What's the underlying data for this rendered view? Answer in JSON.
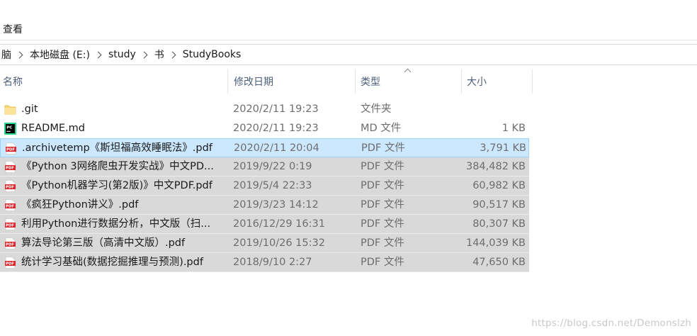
{
  "ribbon": {
    "view_tab": "查看"
  },
  "breadcrumb": [
    "脑",
    "本地磁盘 (E:)",
    "study",
    "书",
    "StudyBooks"
  ],
  "columns": {
    "name": "名称",
    "date": "修改日期",
    "type": "类型",
    "size": "大小"
  },
  "files": [
    {
      "name": ".git",
      "date": "2020/2/11 19:23",
      "type": "文件夹",
      "size": "",
      "icon": "folder-icon",
      "state": "normal"
    },
    {
      "name": "README.md",
      "date": "2020/2/11 19:23",
      "type": "MD 文件",
      "size": "1 KB",
      "icon": "pycharm-file-icon",
      "state": "normal"
    },
    {
      "name": ".archivetemp《斯坦福高效睡眠法》.pdf",
      "date": "2020/2/11 20:04",
      "type": "PDF 文件",
      "size": "3,791 KB",
      "icon": "pdf-icon",
      "state": "selected"
    },
    {
      "name": "《Python 3网络爬虫开发实战》中文PD...",
      "date": "2019/9/22 0:19",
      "type": "PDF 文件",
      "size": "384,482 KB",
      "icon": "pdf-icon",
      "state": "gray"
    },
    {
      "name": "《Python机器学习(第2版)》中文PDF.pdf",
      "date": "2019/5/4 22:33",
      "type": "PDF 文件",
      "size": "60,982 KB",
      "icon": "pdf-icon",
      "state": "gray"
    },
    {
      "name": "《疯狂Python讲义》.pdf",
      "date": "2019/3/23 14:12",
      "type": "PDF 文件",
      "size": "90,517 KB",
      "icon": "pdf-icon",
      "state": "gray"
    },
    {
      "name": "利用Python进行数据分析，中文版（扫...",
      "date": "2016/12/29 16:31",
      "type": "PDF 文件",
      "size": "80,307 KB",
      "icon": "pdf-icon",
      "state": "gray"
    },
    {
      "name": "算法导论第三版（高清中文版）.pdf",
      "date": "2019/10/26 15:32",
      "type": "PDF 文件",
      "size": "144,039 KB",
      "icon": "pdf-icon",
      "state": "gray"
    },
    {
      "name": "统计学习基础(数据挖掘推理与预测).pdf",
      "date": "2018/9/10 2:27",
      "type": "PDF 文件",
      "size": "47,650 KB",
      "icon": "pdf-icon",
      "state": "gray"
    }
  ],
  "watermark": "https://blog.csdn.net/Demonslzh",
  "colors": {
    "selected_bg": "#cce8ff",
    "selected_border": "#99d1ff",
    "gray_row_bg": "#d9d9d9",
    "header_text": "#4c607a",
    "pdf_red": "#d9272e",
    "folder_yellow": "#f8d775"
  }
}
